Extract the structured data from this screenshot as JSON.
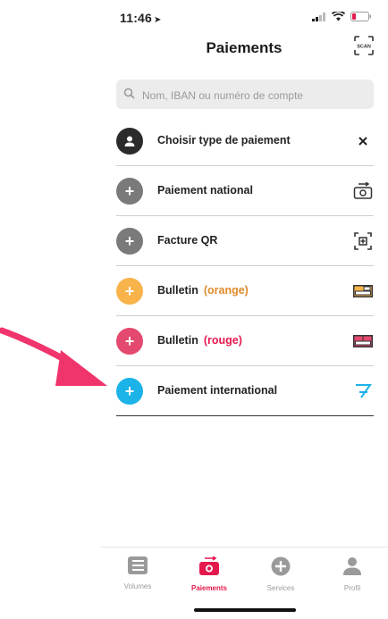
{
  "status": {
    "time": "11:46",
    "location_arrow": "➤"
  },
  "header": {
    "title": "Paiements",
    "scan_label": "SCAN"
  },
  "search": {
    "placeholder": "Nom, IBAN ou numéro de compte"
  },
  "items": [
    {
      "label": "Choisir type de paiement",
      "sub": "",
      "circle_color": "#2b2b2b",
      "icon": "close-icon"
    },
    {
      "label": "Paiement national",
      "sub": "",
      "circle_color": "#7a7a7a",
      "icon": "camera-icon"
    },
    {
      "label": "Facture QR",
      "sub": "",
      "circle_color": "#7a7a7a",
      "icon": "qr-scan-icon"
    },
    {
      "label": "Bulletin",
      "sub": "(orange)",
      "sub_color": "#e08a2a",
      "circle_color": "#f8b34b",
      "icon": "orange-slip-icon"
    },
    {
      "label": "Bulletin",
      "sub": "(rouge)",
      "sub_color": "#e5184d",
      "circle_color": "#e4496f",
      "icon": "red-slip-icon"
    },
    {
      "label": "Paiement international",
      "sub": "",
      "circle_color": "#1bb3e8",
      "icon": "international-icon"
    }
  ],
  "tabs": [
    {
      "label": "Volumes",
      "icon": "list-icon"
    },
    {
      "label": "Paiements",
      "icon": "payment-camera-icon",
      "active": true
    },
    {
      "label": "Services",
      "icon": "plus-circle-icon"
    },
    {
      "label": "Profil",
      "icon": "user-icon"
    }
  ],
  "colors": {
    "accent": "#e5184d",
    "pointer": "#f0346c"
  }
}
